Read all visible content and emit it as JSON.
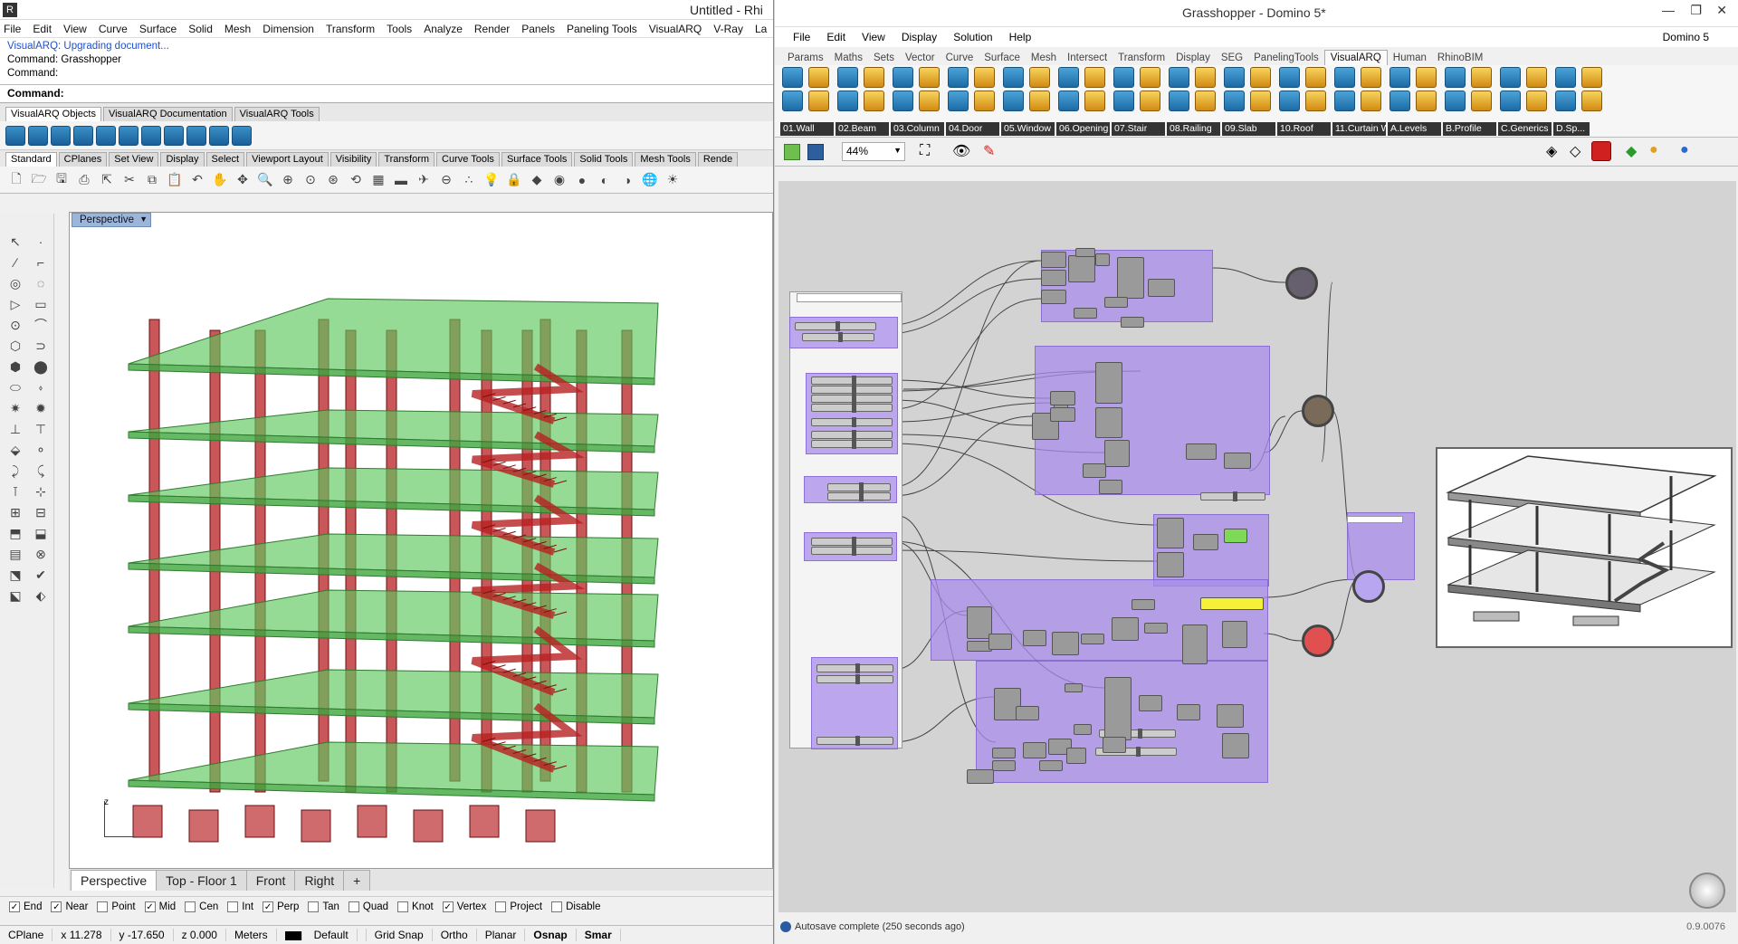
{
  "rhino": {
    "title": "Untitled - Rhi",
    "menu": [
      "File",
      "Edit",
      "View",
      "Curve",
      "Surface",
      "Solid",
      "Mesh",
      "Dimension",
      "Transform",
      "Tools",
      "Analyze",
      "Render",
      "Panels",
      "Paneling Tools",
      "VisualARQ",
      "V-Ray",
      "La"
    ],
    "history": [
      "VisualARQ: Upgrading document...",
      "Command: Grasshopper",
      "Command:"
    ],
    "command_label": "Command:",
    "toolbar_tabs": [
      "VisualARQ Objects",
      "VisualARQ Documentation",
      "VisualARQ Tools"
    ],
    "std_tabs": [
      "Standard",
      "CPlanes",
      "Set View",
      "Display",
      "Select",
      "Viewport Layout",
      "Visibility",
      "Transform",
      "Curve Tools",
      "Surface Tools",
      "Solid Tools",
      "Mesh Tools",
      "Rende"
    ],
    "viewport_label": "Perspective",
    "axis_label": "z",
    "viewport_tabs": [
      "Perspective",
      "Top - Floor 1",
      "Front",
      "Right",
      "+"
    ],
    "osnaps": [
      {
        "label": "End",
        "checked": true
      },
      {
        "label": "Near",
        "checked": true
      },
      {
        "label": "Point",
        "checked": false
      },
      {
        "label": "Mid",
        "checked": true
      },
      {
        "label": "Cen",
        "checked": false
      },
      {
        "label": "Int",
        "checked": false
      },
      {
        "label": "Perp",
        "checked": true
      },
      {
        "label": "Tan",
        "checked": false
      },
      {
        "label": "Quad",
        "checked": false
      },
      {
        "label": "Knot",
        "checked": false
      },
      {
        "label": "Vertex",
        "checked": true
      },
      {
        "label": "Project",
        "checked": false
      },
      {
        "label": "Disable",
        "checked": false
      }
    ],
    "status": {
      "cplane": "CPlane",
      "x": "x 11.278",
      "y": "y -17.650",
      "z": "z 0.000",
      "units": "Meters",
      "layer": "Default",
      "grid": "Grid Snap",
      "ortho": "Ortho",
      "planar": "Planar",
      "osnap": "Osnap",
      "smart": "Smar"
    }
  },
  "grasshopper": {
    "title": "Grasshopper - Domino 5*",
    "menu": [
      "File",
      "Edit",
      "View",
      "Display",
      "Solution",
      "Help"
    ],
    "doc_name": "Domino 5",
    "tabs": [
      "Params",
      "Maths",
      "Sets",
      "Vector",
      "Curve",
      "Surface",
      "Mesh",
      "Intersect",
      "Transform",
      "Display",
      "SEG",
      "PanelingTools",
      "VisualARQ",
      "Human",
      "RhinoBIM"
    ],
    "active_tab": "VisualARQ",
    "ribbon_groups": [
      "01.Wall",
      "02.Beam",
      "03.Column",
      "04.Door",
      "05.Window",
      "06.Opening",
      "07.Stair",
      "08.Railing",
      "09.Slab",
      "10.Roof",
      "11.Curtain W...",
      "A.Levels",
      "B.Profile",
      "C.Generics",
      "D.Sp..."
    ],
    "zoom": "44%",
    "status_message": "Autosave complete (250 seconds ago)",
    "version": "0.9.0076"
  },
  "colors": {
    "slab": "#5cc85c",
    "column": "#c0393c",
    "group": "#aa8ceb",
    "accent": "#1d6aa5"
  }
}
